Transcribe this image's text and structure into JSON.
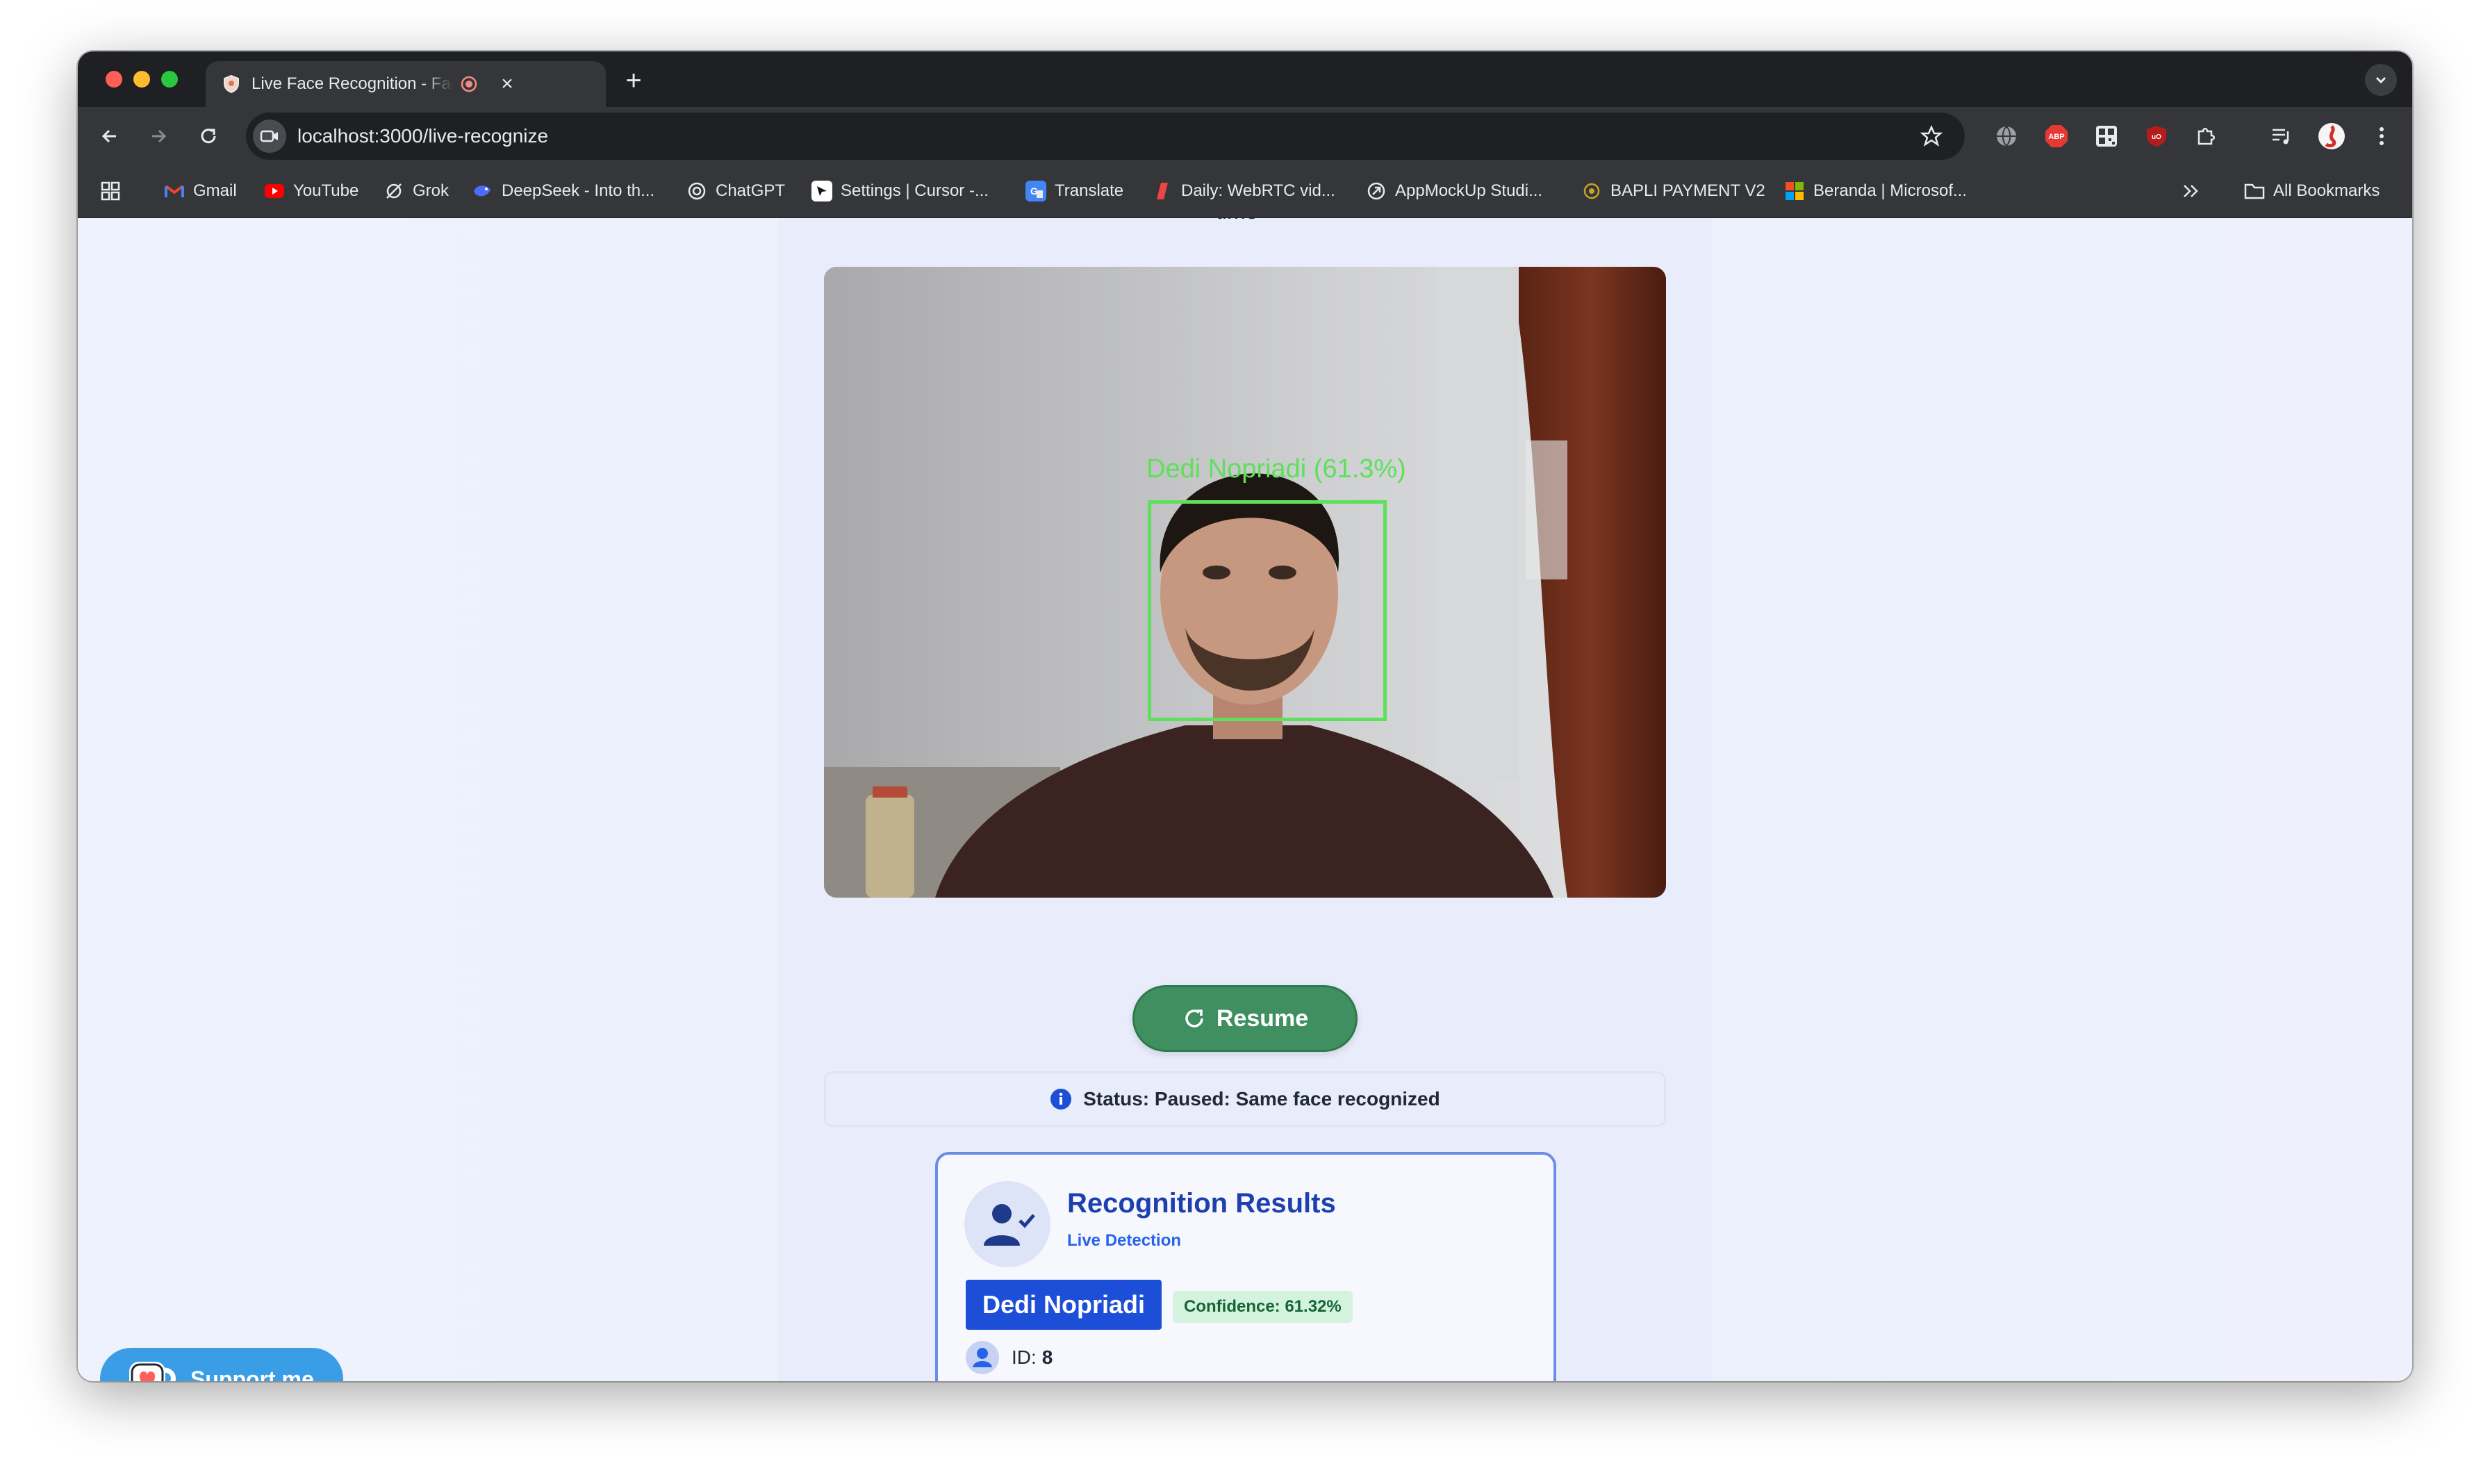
{
  "tab": {
    "title": "Live Face Recognition - Face"
  },
  "omnibox": {
    "url": "localhost:3000/live-recognize"
  },
  "bookmarks": [
    {
      "label": "Gmail",
      "icon": "gmail-icon",
      "color": "#ea4335"
    },
    {
      "label": "YouTube",
      "icon": "youtube-icon",
      "color": "#ff0000"
    },
    {
      "label": "Grok",
      "icon": "grok-icon",
      "color": "#e8eaed"
    },
    {
      "label": "DeepSeek - Into th...",
      "icon": "deepseek-icon",
      "color": "#4d6bfe"
    },
    {
      "label": "ChatGPT",
      "icon": "chatgpt-icon",
      "color": "#e8eaed"
    },
    {
      "label": "Settings | Cursor -...",
      "icon": "cursor-icon",
      "color": "#ffffff"
    },
    {
      "label": "Translate",
      "icon": "translate-icon",
      "color": "#4285f4"
    },
    {
      "label": "Daily: WebRTC vid...",
      "icon": "daily-icon",
      "color": "#ef4444"
    },
    {
      "label": "AppMockUp Studi...",
      "icon": "appmockup-icon",
      "color": "#e8eaed"
    },
    {
      "label": "BAPLI PAYMENT V2",
      "icon": "bapli-icon",
      "color": "#c9a227"
    },
    {
      "label": "Beranda | Microsof...",
      "icon": "microsoft-icon",
      "color": "#f25022"
    }
  ],
  "all_bookmarks": "All Bookmarks",
  "page": {
    "heading_fragment": "time",
    "face_label": "Dedi Nopriadi (61.3%)",
    "resume_label": "Resume",
    "status_text": "Status: Paused: Same face recognized",
    "card": {
      "title": "Recognition Results",
      "subtitle": "Live Detection",
      "name": "Dedi Nopriadi",
      "confidence": "Confidence: 61.32%",
      "id_label": "ID:",
      "id_value": "8"
    },
    "support_label": "Support me"
  },
  "colors": {
    "accent_blue": "#1d4ed8",
    "resume_green": "#3f8f60",
    "face_box_green": "#5ee05a",
    "support_blue": "#3a9ee6"
  }
}
